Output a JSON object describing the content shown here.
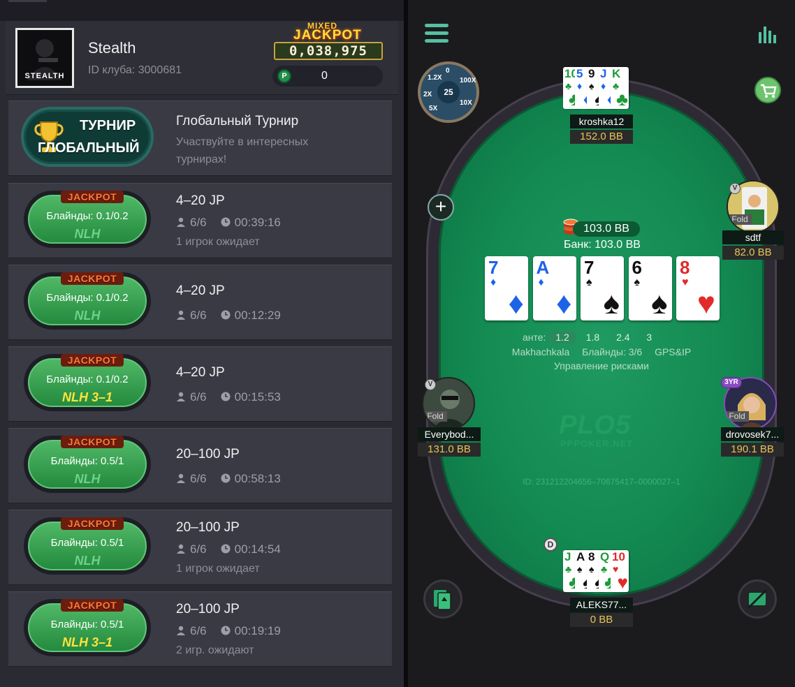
{
  "profile": {
    "username": "Stealth",
    "club_id": "ID клуба: 3000681",
    "avatar_text": "STEALTH",
    "jackpot_mixed": "MIXED",
    "jackpot_word": "JACKPOT",
    "jackpot_value": "0,038,975",
    "p_icon": "P",
    "chip_balance": "0"
  },
  "tournament": {
    "badge_line1": "ТУРНИР",
    "badge_line2": "ГЛОБАЛЬНЫЙ",
    "title": "Глобальный Турнир",
    "desc_line1": "Участвуйте в интересных",
    "desc_line2": "турнирах!"
  },
  "games": [
    {
      "tag": "JACKPOT",
      "blinds": "Блайнды: 0.1/0.2",
      "type": "NLH",
      "title": "4–20 JP",
      "players": "6/6",
      "time": "00:39:16",
      "waiting": "1 игрок ожидает"
    },
    {
      "tag": "JACKPOT",
      "blinds": "Блайнды: 0.1/0.2",
      "type": "NLH",
      "title": "4–20 JP",
      "players": "6/6",
      "time": "00:12:29",
      "waiting": ""
    },
    {
      "tag": "JACKPOT",
      "blinds": "Блайнды: 0.1/0.2",
      "type": "NLH 3–1",
      "title": "4–20 JP",
      "players": "6/6",
      "time": "00:15:53",
      "waiting": ""
    },
    {
      "tag": "JACKPOT",
      "blinds": "Блайнды: 0.5/1",
      "type": "NLH",
      "title": "20–100 JP",
      "players": "6/6",
      "time": "00:58:13",
      "waiting": ""
    },
    {
      "tag": "JACKPOT",
      "blinds": "Блайнды: 0.5/1",
      "type": "NLH",
      "title": "20–100 JP",
      "players": "6/6",
      "time": "00:14:54",
      "waiting": "1 игрок ожидает"
    },
    {
      "tag": "JACKPOT",
      "blinds": "Блайнды: 0.5/1",
      "type": "NLH 3–1",
      "title": "20–100 JP",
      "players": "6/6",
      "time": "00:19:19",
      "waiting": "2 игр. ожидают"
    }
  ],
  "table": {
    "wheel": {
      "center": "25",
      "labels": [
        "1.2X",
        "0",
        "100X",
        "10X",
        "5X",
        "2X"
      ]
    },
    "pot_bet": "103.0 BB",
    "pot_bank": "Банк: 103.0 BB",
    "board": [
      {
        "rank": "7",
        "suit": "♦",
        "color": "blue"
      },
      {
        "rank": "A",
        "suit": "♦",
        "color": "blue"
      },
      {
        "rank": "7",
        "suit": "♠",
        "color": "black"
      },
      {
        "rank": "6",
        "suit": "♠",
        "color": "black"
      },
      {
        "rank": "8",
        "suit": "♥",
        "color": "red"
      }
    ],
    "ante_label": "анте:",
    "ante_values": [
      "1.2",
      "1.8",
      "2.4",
      "3"
    ],
    "location": "Makhachkala",
    "blinds": "Блайнды: 3/6",
    "gps": "GPS&IP",
    "risk": "Управление рисками",
    "watermark": "PLO5",
    "watermark_sub": "PPPOKER.NET",
    "hand_id": "ID: 231212204656–70675417–0000027–1",
    "dealer": "D",
    "fold_label": "Fold",
    "v_badge": "V",
    "yr_badge": "3YR",
    "players": {
      "top": {
        "name": "kroshka12",
        "stack": "152.0 BB",
        "cards": [
          {
            "rank": "10",
            "suit": "♣",
            "color": "green"
          },
          {
            "rank": "5",
            "suit": "♦",
            "color": "blue"
          },
          {
            "rank": "9",
            "suit": "♠",
            "color": "black"
          },
          {
            "rank": "J",
            "suit": "♦",
            "color": "blue"
          },
          {
            "rank": "K",
            "suit": "♣",
            "color": "green"
          }
        ]
      },
      "right_top": {
        "name": "sdtf",
        "stack": "82.0 BB"
      },
      "left": {
        "name": "Everybod...",
        "stack": "131.0 BB"
      },
      "right": {
        "name": "drovosek7...",
        "stack": "190.1 BB"
      },
      "bottom": {
        "name": "ALEKS77...",
        "stack": "0 BB",
        "cards": [
          {
            "rank": "J",
            "suit": "♣",
            "color": "green"
          },
          {
            "rank": "A",
            "suit": "♠",
            "color": "black"
          },
          {
            "rank": "8",
            "suit": "♠",
            "color": "black"
          },
          {
            "rank": "Q",
            "suit": "♣",
            "color": "green"
          },
          {
            "rank": "10",
            "suit": "♥",
            "color": "red"
          }
        ]
      }
    }
  },
  "colors": {
    "felt": "#138a52",
    "accent": "#2aa86c",
    "lobby_bg": "#2a2a33",
    "item_bg": "#3a3a45",
    "stack_text": "#e8c35a"
  },
  "icons": [
    "menu-icon",
    "stats-icon",
    "cart-icon",
    "plus-icon",
    "person-icon",
    "clock-icon",
    "trophy-icon",
    "spade-cards-icon",
    "no-cards-icon"
  ]
}
